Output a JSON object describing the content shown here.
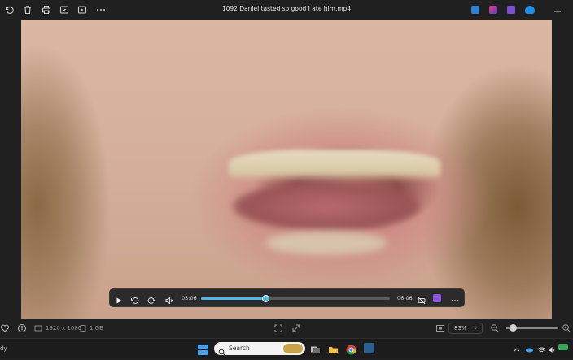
{
  "window": {
    "title": "1092 Daniel tasted so good I ate him.mp4"
  },
  "toolbar": {
    "icons": [
      "rotate-icon",
      "delete-icon",
      "print-icon",
      "edit-icon",
      "slideshow-icon",
      "more-icon"
    ]
  },
  "player": {
    "current_time": "03:06",
    "total_time": "06:06",
    "progress_fraction": 0.34
  },
  "status": {
    "dimensions": "1920 x 1080",
    "size": "1 GB",
    "zoom": "83%"
  },
  "taskbar": {
    "search_placeholder": "Search",
    "left_text": "dy"
  },
  "colors": {
    "accent": "#4fb7e8",
    "background": "#202020"
  }
}
